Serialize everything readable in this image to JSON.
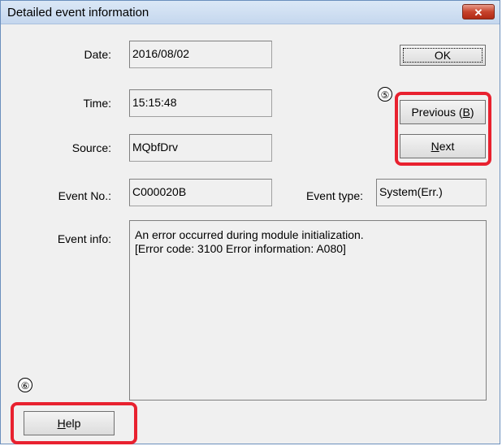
{
  "dialog": {
    "title": "Detailed event information",
    "close_label": "✕"
  },
  "fields": {
    "date_label": "Date:",
    "date_value": "2016/08/02",
    "time_label": "Time:",
    "time_value": "15:15:48",
    "source_label": "Source:",
    "source_value": "MQbfDrv",
    "event_no_label": "Event No.:",
    "event_no_value": "C000020B",
    "event_type_label": "Event type:",
    "event_type_value": "System(Err.)",
    "event_info_label": "Event info:",
    "event_info_line1": "An error occurred during module initialization.",
    "event_info_line2": "[Error code: 3100 Error information:  A080]"
  },
  "buttons": {
    "ok_label": "OK",
    "previous_label": "Previous (",
    "previous_key": "B",
    "previous_suffix": ")",
    "next_key": "N",
    "next_rest": "ext",
    "help_key": "H",
    "help_rest": "elp"
  },
  "annotations": {
    "marker_5": "⑤",
    "marker_6": "⑥",
    "highlight_color": "#e8212f"
  }
}
